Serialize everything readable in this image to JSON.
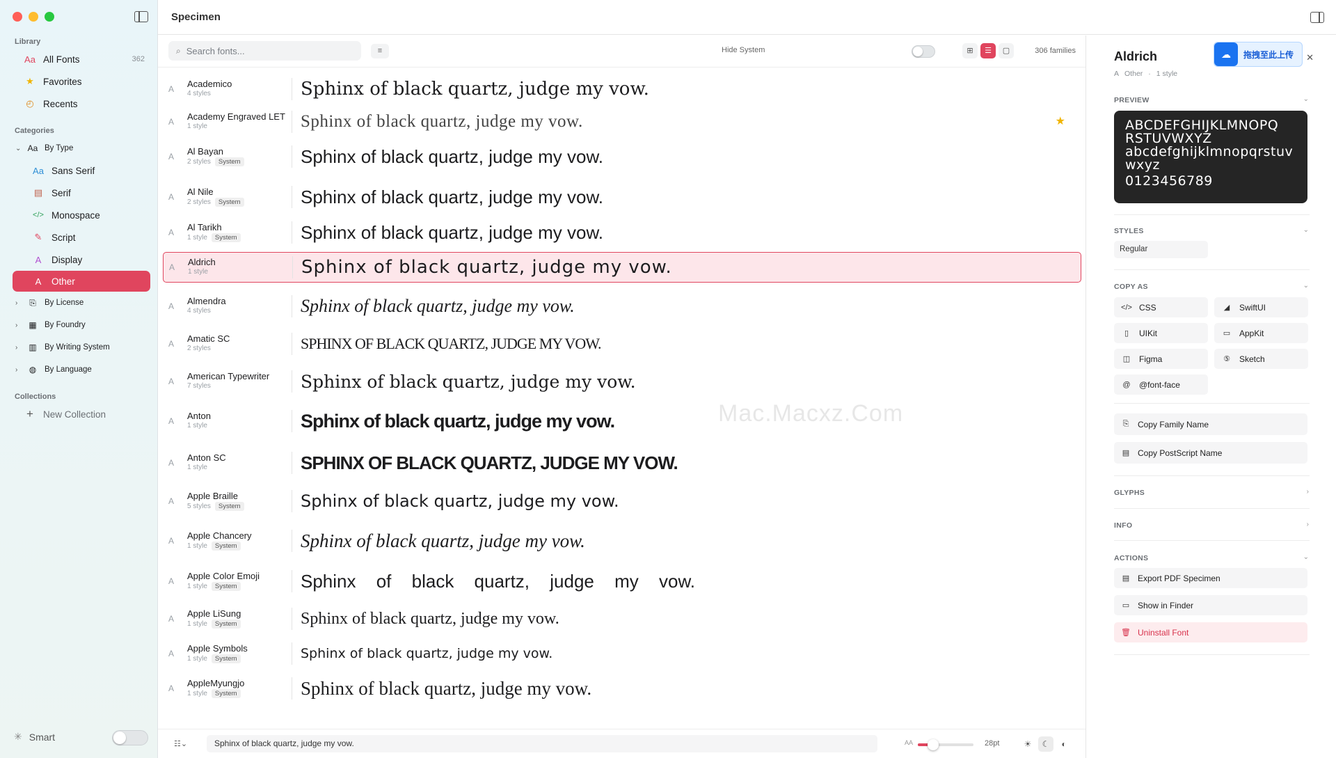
{
  "app": {
    "title": "Specimen"
  },
  "colors": {
    "accent": "#e0455e",
    "favorite": "#f0b400",
    "danger": "#d8324c",
    "upload": "#1a73f0"
  },
  "sidebar": {
    "library_header": "Library",
    "library": [
      {
        "label": "All Fonts",
        "icon": "Aa",
        "count": "362"
      },
      {
        "label": "Favorites",
        "icon": "★",
        "count": ""
      },
      {
        "label": "Recents",
        "icon": "◴",
        "count": ""
      }
    ],
    "categories_header": "Categories",
    "by_type": {
      "label": "By Type",
      "icon": "Aa",
      "chevron": "⌄"
    },
    "types": [
      {
        "label": "Sans Serif",
        "icon": "Aa"
      },
      {
        "label": "Serif",
        "icon": "▤"
      },
      {
        "label": "Monospace",
        "icon": "</>"
      },
      {
        "label": "Script",
        "icon": "✎"
      },
      {
        "label": "Display",
        "icon": "A"
      },
      {
        "label": "Other",
        "icon": "A"
      }
    ],
    "groups": [
      {
        "label": "By License",
        "icon": "⎘"
      },
      {
        "label": "By Foundry",
        "icon": "▦"
      },
      {
        "label": "By Writing System",
        "icon": "▥"
      },
      {
        "label": "By Language",
        "icon": "◍"
      }
    ],
    "collections_header": "Collections",
    "new_collection": {
      "label": "New Collection",
      "icon": "+"
    },
    "smart": {
      "label": "Smart",
      "icon": "✳"
    }
  },
  "toolbar": {
    "search_placeholder": "Search fonts...",
    "filter_icon": "≡",
    "hide_system_label": "Hide System",
    "view_icons": [
      "⊞",
      "☰",
      "▢"
    ],
    "families_count": "306 families"
  },
  "fonts": [
    {
      "name": "Academico",
      "styles": "4 styles",
      "badge": "",
      "favorite": false
    },
    {
      "name": "Academy Engraved LET",
      "styles": "1 style",
      "badge": "",
      "favorite": true
    },
    {
      "name": "Al Bayan",
      "styles": "2 styles",
      "badge": "System",
      "favorite": false
    },
    {
      "name": "Al Nile",
      "styles": "2 styles",
      "badge": "System",
      "favorite": false
    },
    {
      "name": "Al Tarikh",
      "styles": "1 style",
      "badge": "System",
      "favorite": false
    },
    {
      "name": "Aldrich",
      "styles": "1 style",
      "badge": "",
      "favorite": false,
      "selected": true
    },
    {
      "name": "Almendra",
      "styles": "4 styles",
      "badge": "",
      "favorite": false
    },
    {
      "name": "Amatic SC",
      "styles": "2 styles",
      "badge": "",
      "favorite": false
    },
    {
      "name": "American Typewriter",
      "styles": "7 styles",
      "badge": "",
      "favorite": false
    },
    {
      "name": "Anton",
      "styles": "1 style",
      "badge": "",
      "favorite": false
    },
    {
      "name": "Anton SC",
      "styles": "1 style",
      "badge": "",
      "favorite": false
    },
    {
      "name": "Apple Braille",
      "styles": "5 styles",
      "badge": "System",
      "favorite": false
    },
    {
      "name": "Apple Chancery",
      "styles": "1 style",
      "badge": "System",
      "favorite": false
    },
    {
      "name": "Apple Color Emoji",
      "styles": "1 style",
      "badge": "System",
      "favorite": false
    },
    {
      "name": "Apple LiSung",
      "styles": "1 style",
      "badge": "System",
      "favorite": false
    },
    {
      "name": "Apple Symbols",
      "styles": "1 style",
      "badge": "System",
      "favorite": false
    },
    {
      "name": "AppleMyungjo",
      "styles": "1 style",
      "badge": "System",
      "favorite": false
    }
  ],
  "sample_text": "Sphinx of black quartz, judge my vow.",
  "sample_text_caps": "SPHINX OF BLACK QUARTZ, JUDGE MY VOW.",
  "watermark": "Mac.Macxz.Com",
  "statusbar": {
    "menu_icon": "☷⌄",
    "sample_text": "Sphinx of black quartz, judge my vow.",
    "size_icon": "AA",
    "size_value": "28pt",
    "size_level": 0.27,
    "theme_icons": [
      "☀",
      "☾",
      "◐"
    ]
  },
  "inspector": {
    "title": "Aldrich",
    "type_icon": "A",
    "category": "Other",
    "separator": "·",
    "style_count": "1 style",
    "close_icon": "✕",
    "upload_label": "拖拽至此上传",
    "preview_header": "PREVIEW",
    "preview_lines": [
      "ABCDEFGHIJKLMNOPQ",
      "RSTUVWXYZ",
      "abcdefghijklmnopqrstuv",
      "wxyz",
      "0123456789"
    ],
    "styles_header": "STYLES",
    "styles": [
      "Regular"
    ],
    "copy_as_header": "COPY AS",
    "copy_as": [
      {
        "label": "CSS",
        "icon": "</>"
      },
      {
        "label": "SwiftUI",
        "icon": "◢"
      },
      {
        "label": "UIKit",
        "icon": "▯"
      },
      {
        "label": "AppKit",
        "icon": "▭"
      },
      {
        "label": "Figma",
        "icon": "◫"
      },
      {
        "label": "Sketch",
        "icon": "⑤"
      },
      {
        "label": "@font-face",
        "icon": "@"
      }
    ],
    "copy_family": {
      "label": "Copy Family Name",
      "icon": "⎘"
    },
    "copy_postscript": {
      "label": "Copy PostScript Name",
      "icon": "▤"
    },
    "glyphs_header": "GLYPHS",
    "info_header": "INFO",
    "actions_header": "ACTIONS",
    "actions": [
      {
        "label": "Export PDF Specimen",
        "icon": "▤"
      },
      {
        "label": "Show in Finder",
        "icon": "▭"
      },
      {
        "label": "Uninstall Font",
        "icon": "🗑"
      }
    ]
  }
}
